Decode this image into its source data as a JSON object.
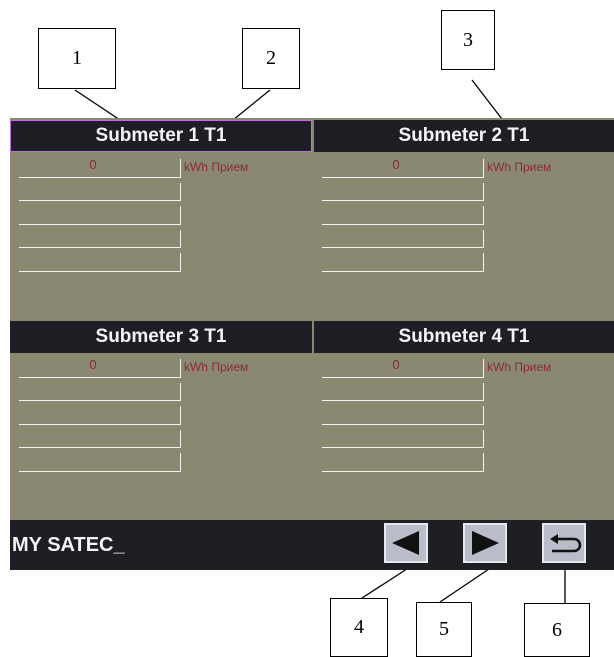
{
  "callouts": [
    "1",
    "2",
    "3",
    "4",
    "5",
    "6"
  ],
  "panels": [
    {
      "title": "Submeter 1 T1",
      "value": "0",
      "unit": "kWh Прием"
    },
    {
      "title": "Submeter 2 T1",
      "value": "0",
      "unit": "kWh Прием"
    },
    {
      "title": "Submeter 3 T1",
      "value": "0",
      "unit": "kWh Прием"
    },
    {
      "title": "Submeter 4 T1",
      "value": "0",
      "unit": "kWh Прием"
    }
  ],
  "status_bar": {
    "brand": "MY SATEC_"
  },
  "buttons": {
    "prev": {
      "icon": "left-triangle-icon"
    },
    "next": {
      "icon": "right-triangle-icon"
    },
    "back": {
      "icon": "return-arrow-icon"
    }
  },
  "colors": {
    "screen_bg": "#8a8870",
    "header_bg": "#1d1f25",
    "value_text": "#8e2a3a",
    "button_bg": "#b9bcc9"
  }
}
